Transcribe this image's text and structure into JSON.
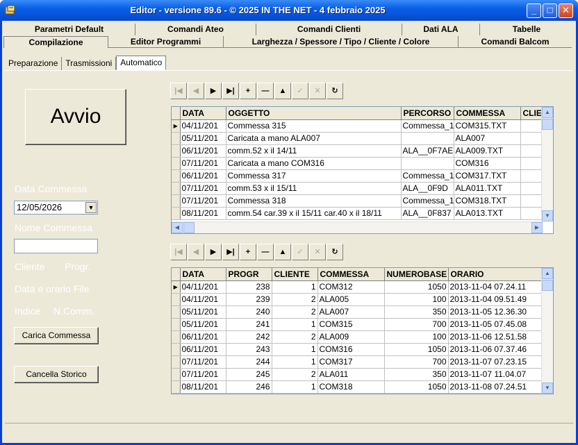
{
  "window": {
    "title": "Editor - versione 89.6 - © 2025  IN THE NET - 4 febbraio 2025",
    "minimize_glyph": "_",
    "maximize_glyph": "□",
    "close_glyph": "✕"
  },
  "tabs": {
    "row1": [
      "Parametri Default",
      "Comandi Ateo",
      "Comandi Clienti",
      "Dati ALA",
      "Tabelle"
    ],
    "row2": [
      "Compilazione",
      "Editor Programmi",
      "Larghezza / Spessore / Tipo / Cliente / Colore",
      "Comandi Balcom"
    ]
  },
  "subtabs": [
    "Preparazione",
    "Trasmissioni",
    "Automatico"
  ],
  "left_panel": {
    "avvio_label": "Avvio",
    "data_commessa_label": "Data Commessa",
    "data_commessa_value": "12/05/2026",
    "dropdown_glyph": "▼",
    "nome_commessa_label": "Nome Commessa",
    "cliente_label": "Cliente",
    "progr_label": "Progr.",
    "data_orario_label": "Data e orario File",
    "indice_label": "Indice",
    "ncomm_label": "N.Comm.",
    "carica_button": "Carica Commessa",
    "cancella_button": "Cancella Storico"
  },
  "navigator": {
    "first": "|◀",
    "prior": "◀",
    "next": "▶",
    "last": "▶|",
    "insert": "+",
    "delete": "—",
    "edit": "▲",
    "post": "✓",
    "cancel": "✕",
    "refresh": "↻"
  },
  "grid1": {
    "columns": [
      "DATA",
      "OGGETTO",
      "PERCORSO",
      "COMMESSA",
      "CLIE"
    ],
    "rows": [
      [
        "04/11/201",
        "Commessa 315",
        "Commessa_1",
        "COM315.TXT",
        ""
      ],
      [
        "05/11/201",
        "Caricata a mano ALA007",
        "",
        "ALA007",
        ""
      ],
      [
        "06/11/201",
        "comm.52 x il 14/11",
        "ALA__0F7AE",
        "ALA009.TXT",
        ""
      ],
      [
        "07/11/201",
        "Caricata a mano COM316",
        "",
        "COM316",
        ""
      ],
      [
        "06/11/201",
        "Commessa 317",
        "Commessa_1",
        "COM317.TXT",
        ""
      ],
      [
        "07/11/201",
        "comm.53 x il 15/11",
        "ALA__0F9D",
        "ALA011.TXT",
        ""
      ],
      [
        "07/11/201",
        "Commessa 318",
        "Commessa_1",
        "COM318.TXT",
        ""
      ],
      [
        "08/11/201",
        "comm.54 car.39 x il 15/11 car.40 x il 18/11",
        "ALA__0F837",
        "ALA013.TXT",
        ""
      ]
    ]
  },
  "grid2": {
    "columns": [
      "DATA",
      "PROGR",
      "CLIENTE",
      "COMMESSA",
      "NUMEROBASE",
      "ORARIO"
    ],
    "rows": [
      [
        "04/11/201",
        "238",
        "1",
        "COM312",
        "1050",
        "2013-11-04 07.24.11"
      ],
      [
        "04/11/201",
        "239",
        "2",
        "ALA005",
        "100",
        "2013-11-04 09.51.49"
      ],
      [
        "05/11/201",
        "240",
        "2",
        "ALA007",
        "350",
        "2013-11-05 12.36.30"
      ],
      [
        "05/11/201",
        "241",
        "1",
        "COM315",
        "700",
        "2013-11-05 07.45.08"
      ],
      [
        "06/11/201",
        "242",
        "2",
        "ALA009",
        "100",
        "2013-11-06 12.51.58"
      ],
      [
        "06/11/201",
        "243",
        "1",
        "COM316",
        "1050",
        "2013-11-06 07.37.46"
      ],
      [
        "07/11/201",
        "244",
        "1",
        "COM317",
        "700",
        "2013-11-07 07.23.15"
      ],
      [
        "07/11/201",
        "245",
        "2",
        "ALA011",
        "350",
        "2013-11-07 11.04.07"
      ],
      [
        "08/11/201",
        "246",
        "1",
        "COM318",
        "1050",
        "2013-11-08 07.24.51"
      ]
    ]
  },
  "colors": {
    "title_blue": "#0a5fe8",
    "face": "#ece9d8",
    "scroll": "#c9daf8"
  }
}
